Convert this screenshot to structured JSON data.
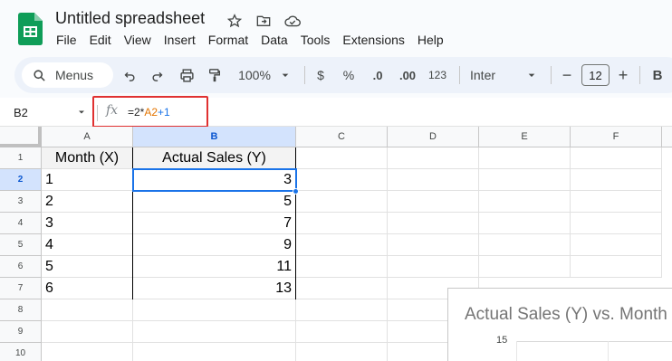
{
  "app": {
    "title": "Untitled spreadsheet",
    "menu": [
      "File",
      "Edit",
      "View",
      "Insert",
      "Format",
      "Data",
      "Tools",
      "Extensions",
      "Help"
    ]
  },
  "toolbar": {
    "menus_label": "Menus",
    "zoom": "100%",
    "currency": "$",
    "percent": "%",
    "dec_decrease": ".0",
    "dec_increase": ".00",
    "more_formats": "123",
    "font": "Inter",
    "minus": "−",
    "font_size": "12",
    "plus": "+",
    "bold": "B"
  },
  "formula_bar": {
    "name_box": "B2",
    "fx": "fx",
    "formula_parts": [
      "=2*",
      "A2",
      "+1"
    ]
  },
  "sheet": {
    "columns": [
      "A",
      "B",
      "C",
      "D",
      "E",
      "F"
    ],
    "rows": [
      "1",
      "2",
      "3",
      "4",
      "5",
      "6",
      "7",
      "8",
      "9",
      "10"
    ],
    "header": [
      "Month (X)",
      "Actual Sales (Y)"
    ],
    "data": [
      [
        "1",
        "3"
      ],
      [
        "2",
        "5"
      ],
      [
        "3",
        "7"
      ],
      [
        "4",
        "9"
      ],
      [
        "5",
        "11"
      ],
      [
        "6",
        "13"
      ]
    ],
    "selected_cell": "B2"
  },
  "chart": {
    "title": "Actual Sales (Y) vs. Month",
    "y_tick_top": "15"
  },
  "colors": {
    "accent": "#1a73e8",
    "highlight": "#e03131",
    "formula_ref": "#e37400"
  }
}
